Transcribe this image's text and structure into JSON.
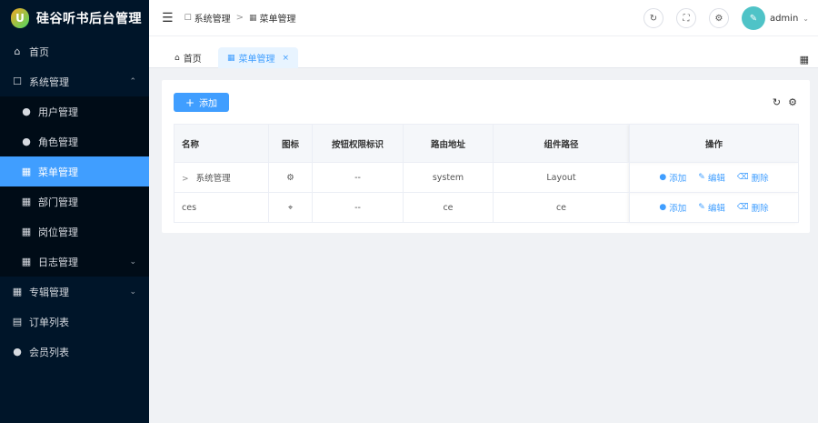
{
  "app": {
    "title": "硅谷听书后台管理",
    "logo_letter": "U"
  },
  "sidebar": {
    "items": [
      {
        "label": "首页",
        "icon": "home-icon"
      },
      {
        "label": "系统管理",
        "icon": "lock-icon",
        "expanded": true,
        "children": [
          {
            "label": "用户管理",
            "icon": "user-icon"
          },
          {
            "label": "角色管理",
            "icon": "user-icon"
          },
          {
            "label": "菜单管理",
            "icon": "grid-icon",
            "active": true
          },
          {
            "label": "部门管理",
            "icon": "grid-icon"
          },
          {
            "label": "岗位管理",
            "icon": "grid-icon"
          },
          {
            "label": "日志管理",
            "icon": "grid-icon",
            "has_children": true
          }
        ]
      },
      {
        "label": "专辑管理",
        "icon": "album-icon",
        "has_children": true
      },
      {
        "label": "订单列表",
        "icon": "clipboard-icon"
      },
      {
        "label": "会员列表",
        "icon": "user-icon"
      }
    ]
  },
  "header": {
    "breadcrumb": [
      "系统管理",
      "菜单管理"
    ],
    "user": "admin"
  },
  "tabs": [
    {
      "label": "首页",
      "icon": "home-icon"
    },
    {
      "label": "菜单管理",
      "icon": "grid-icon",
      "active": true
    }
  ],
  "toolbar": {
    "add_label": "添加"
  },
  "table": {
    "columns": [
      "名称",
      "图标",
      "按钮权限标识",
      "路由地址",
      "组件路径",
      "操作"
    ],
    "rows": [
      {
        "name": "系统管理",
        "expandable": true,
        "icon": "gear-icon",
        "perm": "--",
        "route": "system",
        "component": "Layout"
      },
      {
        "name": "ces",
        "expandable": false,
        "icon": "crosshair-icon",
        "perm": "--",
        "route": "ce",
        "component": "ce"
      }
    ],
    "actions": {
      "add": "添加",
      "edit": "编辑",
      "delete": "删除"
    }
  },
  "colors": {
    "primary": "#409eff",
    "sidebar_bg": "#001529"
  }
}
